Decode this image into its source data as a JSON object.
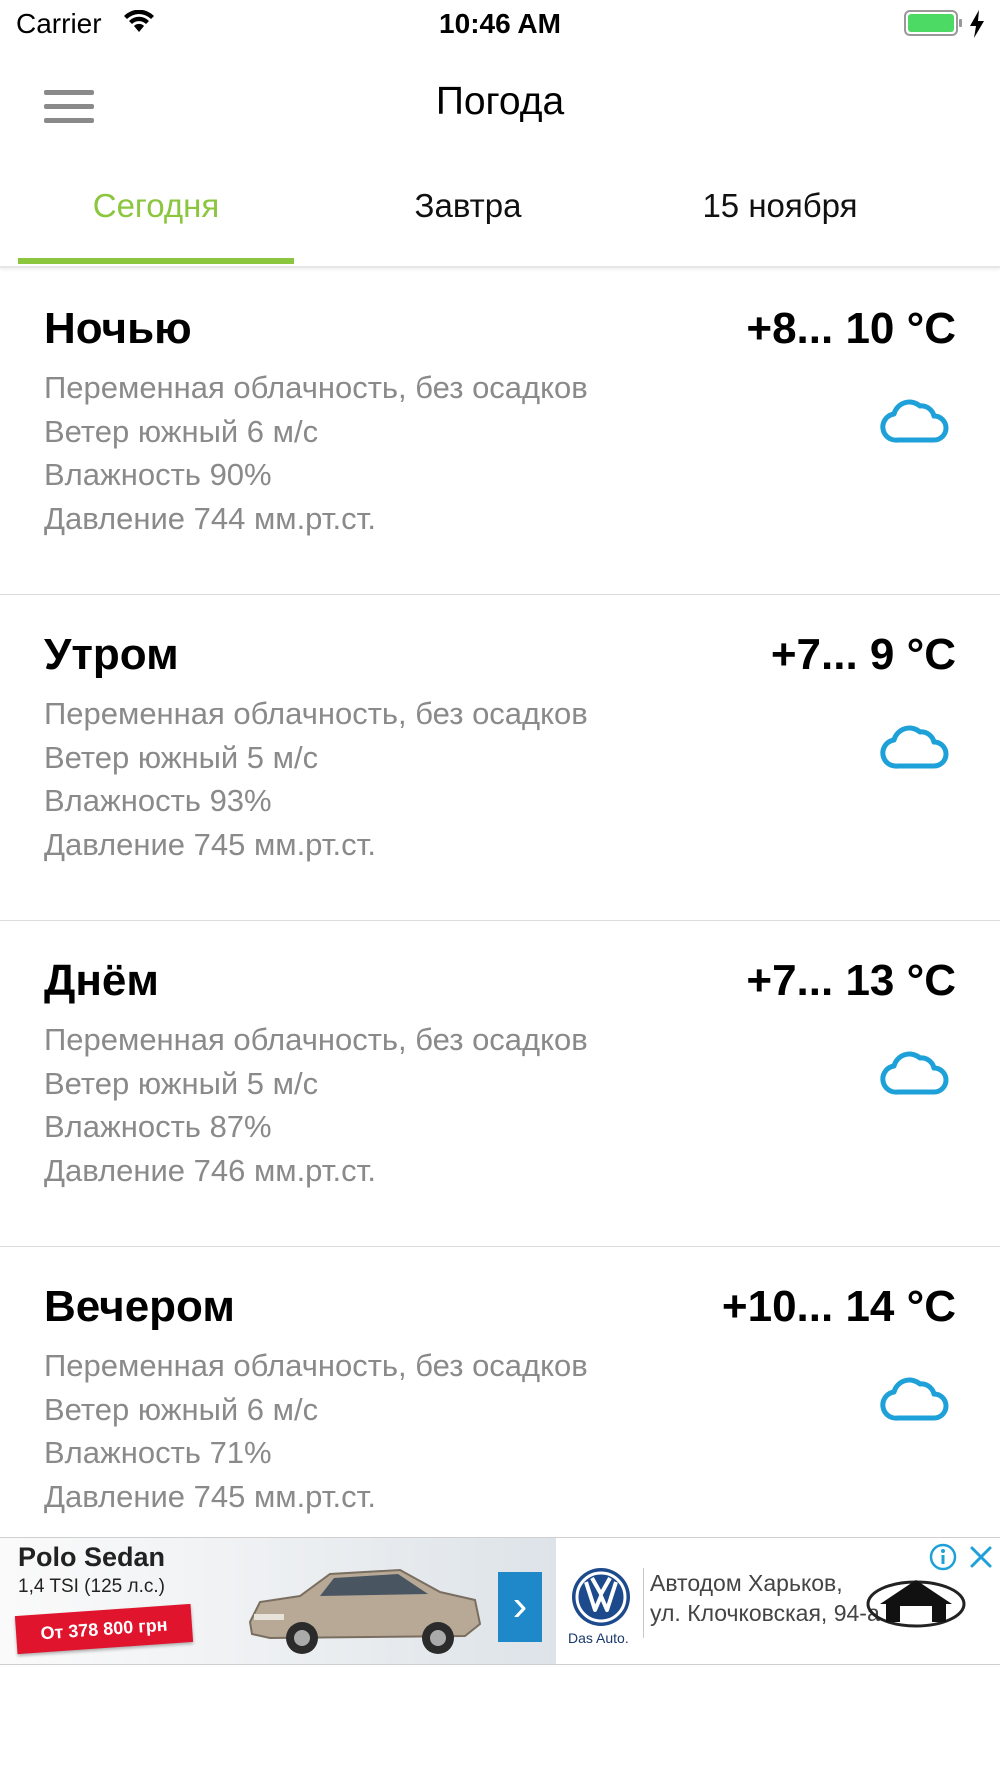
{
  "status_bar": {
    "carrier": "Carrier",
    "time": "10:46 AM"
  },
  "header": {
    "title": "Погода",
    "menu_icon": "hamburger-menu-icon"
  },
  "tabs": [
    {
      "label": "Сегодня",
      "active": true
    },
    {
      "label": "Завтра",
      "active": false
    },
    {
      "label": "15 ноября",
      "active": false
    }
  ],
  "periods": [
    {
      "name": "Ночью",
      "temp": "+8... 10 °C",
      "conditions": "Переменная облачность, без осадков",
      "wind": "Ветер южный 6 м/с",
      "humidity": "Влажность 90%",
      "pressure": "Давление 744 мм.рт.ст.",
      "icon": "cloud-icon"
    },
    {
      "name": "Утром",
      "temp": "+7... 9 °C",
      "conditions": "Переменная облачность, без осадков",
      "wind": "Ветер южный 5 м/с",
      "humidity": "Влажность 93%",
      "pressure": "Давление 745 мм.рт.ст.",
      "icon": "cloud-icon"
    },
    {
      "name": "Днём",
      "temp": "+7... 13 °C",
      "conditions": "Переменная облачность, без осадков",
      "wind": "Ветер южный 5 м/с",
      "humidity": "Влажность 87%",
      "pressure": "Давление 746 мм.рт.ст.",
      "icon": "cloud-icon"
    },
    {
      "name": "Вечером",
      "temp": "+10... 14 °C",
      "conditions": "Переменная облачность, без осадков",
      "wind": "Ветер южный 6 м/с",
      "humidity": "Влажность 71%",
      "pressure": "Давление 745 мм.рт.ст.",
      "icon": "cloud-icon"
    }
  ],
  "ad": {
    "model": "Polo Sedan",
    "engine": "1,4 TSI (125 л.с.)",
    "price": "От 378 800 грн",
    "brand_tagline": "Das Auto.",
    "dealer_line1": "Автодом Харьков,",
    "dealer_line2": "ул. Клочковская, 94-а"
  },
  "colors": {
    "accent": "#8cc63f",
    "icon_blue": "#1ea0d8",
    "secondary_text": "#8a8a8a"
  }
}
